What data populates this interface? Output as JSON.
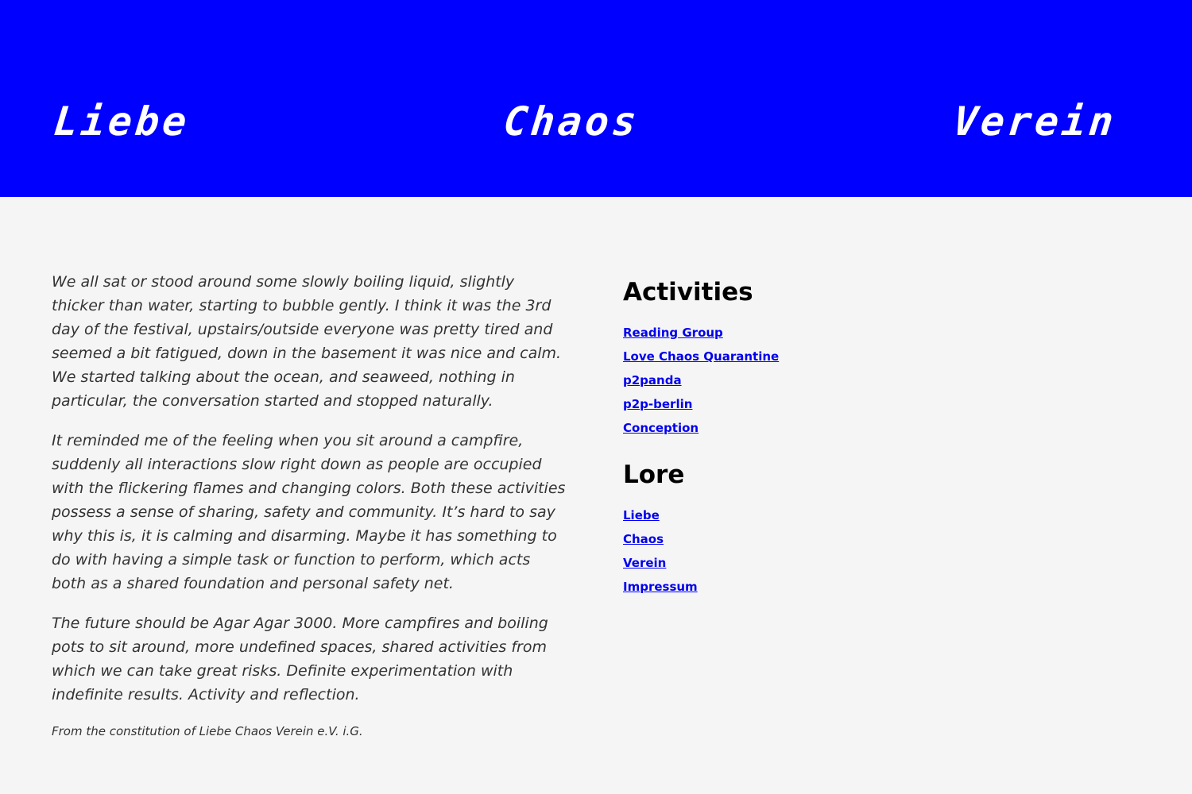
{
  "header": {
    "words": [
      "Liebe",
      "Chaos",
      "Verein"
    ],
    "background_color": "#0000ff",
    "text_color": "#ffffff"
  },
  "main": {
    "paragraphs": [
      "We all sat or stood around some slowly boiling liquid, slightly thicker than water, starting to bubble gently. I think it was the 3rd day of the festival, upstairs/outside everyone was pretty tired and seemed a bit fatigued, down in the basement it was nice and calm. We started talk­ing about the ocean, and seaweed, nothing in particular, the conversa­tion started and stopped naturally.",
      "It reminded me of the feeling when you sit around a campfire, sudden­ly all interactions slow right down as people are occupied with the flickering flames and changing colors. Both these activities possess a sense of sharing, safety and community. It’s hard to say why this is, it is calming and disarming. Maybe it has something to do with having a simple task or function to perform, which acts both as a shared foun­dation and personal safety net.",
      "The future should be Agar Agar 3000. More campfires and boiling pots to sit around, more undefined spaces, shared activities from which we can take great risks. Definite experimentation with indefinite results. Activity and reflection."
    ],
    "attribution": "From the constitution of Liebe Chaos Verein e.V. i.G."
  },
  "sidebar": {
    "activities_heading": "Activities",
    "activities": [
      "Reading Group",
      "Love Chaos Quarantine",
      "p2panda",
      "p2p-berlin",
      "Conception"
    ],
    "lore_heading": "Lore",
    "lore": [
      "Liebe",
      "Chaos",
      "Verein",
      "Impressum"
    ],
    "link_color": "#0000ee"
  }
}
